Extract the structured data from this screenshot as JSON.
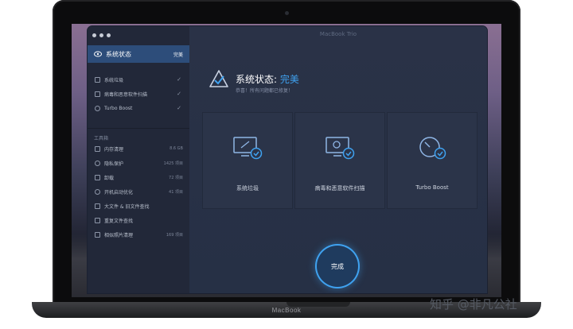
{
  "window": {
    "title": "MacBook Trio"
  },
  "device": {
    "label": "MacBook"
  },
  "sidebar": {
    "active": {
      "label": "系统状态",
      "status": "完美"
    },
    "scan_items": [
      {
        "label": "系统垃圾",
        "check": "✓"
      },
      {
        "label": "病毒和恶意软件扫描",
        "check": "✓"
      },
      {
        "label": "Turbo Boost",
        "check": "✓"
      }
    ],
    "tools_section": "工具箱",
    "tools": [
      {
        "label": "内存清理",
        "size": "8.6 GB"
      },
      {
        "label": "隐私保护",
        "size": "1425 项目"
      },
      {
        "label": "卸载",
        "size": "72 项目"
      },
      {
        "label": "开机启动优化",
        "size": "41 项目"
      },
      {
        "label": "大文件 & 旧文件查找",
        "size": ""
      },
      {
        "label": "重复文件查找",
        "size": ""
      },
      {
        "label": "相似照片清理",
        "size": "169 项目"
      }
    ]
  },
  "main": {
    "status_label": "系统状态:",
    "status_value": "完美",
    "status_sub": "恭喜！所有问题都已修复！",
    "cards": [
      {
        "label": "系统垃圾",
        "icon": "monitor-check-icon"
      },
      {
        "label": "病毒和恶意软件扫描",
        "icon": "monitor-scan-icon"
      },
      {
        "label": "Turbo Boost",
        "icon": "speedometer-check-icon"
      }
    ],
    "done_button": "完成"
  },
  "watermark": "知乎 @非凡公社",
  "colors": {
    "accent": "#3fa2f0",
    "active_row": "#2d4d7a",
    "sidebar_bg": "#222839",
    "main_bg": "#283045"
  }
}
